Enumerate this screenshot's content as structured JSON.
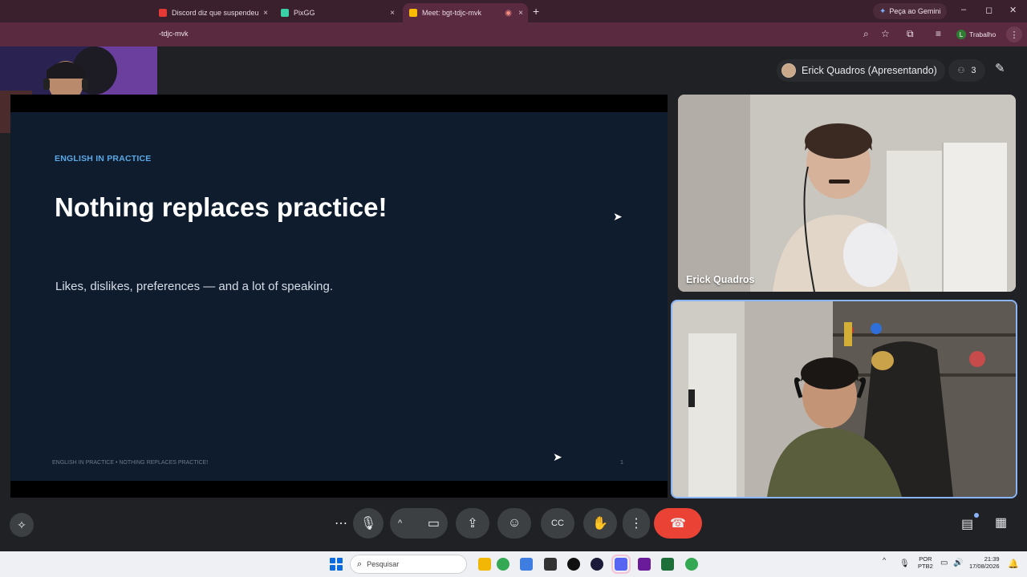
{
  "browser": {
    "tabs": [
      {
        "label": "Discord diz que suspendeu live",
        "close": "×",
        "favicon_color": "#e53935"
      },
      {
        "label": "PixGG",
        "close": "×",
        "favicon_color": "#3ad0a8"
      },
      {
        "label": "Meet: bgt-tdjc-mvk",
        "close": "×",
        "favicon_color": "#fbbc04"
      }
    ],
    "new_tab": "+",
    "gemini_button": "Peça ao Gemini",
    "window_controls": {
      "minimize": "–",
      "maximize": "◻",
      "close": "✕"
    },
    "url": "-tdjc-mvk",
    "profile": {
      "initial": "L",
      "label": "Trabalho"
    },
    "menu": "⋮"
  },
  "meet": {
    "presenter_label": "Erick Quadros (Apresentando)",
    "participant_count": "3",
    "slide": {
      "kicker": "ENGLISH IN PRACTICE",
      "title": "Nothing replaces practice!",
      "subtitle": "Likes, dislikes, preferences — and a lot of speaking.",
      "footer": "ENGLISH IN PRACTICE  •  NOTHING REPLACES PRACTICE!",
      "page_number": "1"
    },
    "tiles": [
      {
        "name": "Erick Quadros"
      }
    ],
    "controls": {
      "more": "⋯",
      "mic": "🎙",
      "chevron": "^",
      "camera": "▭",
      "present": "⇪",
      "emoji": "☺",
      "captions": "CC",
      "raise_hand": "✋",
      "options": "⋮",
      "end_call": "☎",
      "chat": "▤",
      "activities": "▦",
      "activity_left": "✧"
    }
  },
  "taskbar": {
    "search_placeholder": "Pesquisar",
    "language_line1": "POR",
    "language_line2": "PTB2",
    "time": "21:39",
    "date": "17/08/2026",
    "tray": "^"
  }
}
